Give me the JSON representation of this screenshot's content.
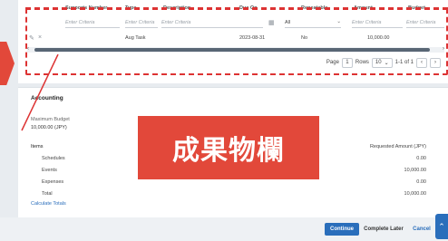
{
  "grid": {
    "columns": [
      "Supports Number",
      "Type",
      "Description",
      "Due On",
      "Repeatable",
      "Amount",
      "Budget"
    ],
    "filters": {
      "placeholder": "Enter Criteria",
      "due_select": "All"
    },
    "row": {
      "description": "Aug Task",
      "due_on": "2023-08-31",
      "repeatable": "No",
      "amount": "10,000.00"
    },
    "pager": {
      "page_label": "Page",
      "page_value": "1",
      "rows_label": "Rows",
      "rows_value": "10",
      "range": "1-1 of 1"
    }
  },
  "accounting": {
    "title": "Accounting",
    "max_budget_label": "Maximum Budget",
    "max_budget_value": "10,000.00 (JPY)",
    "items_header": "Items",
    "requested_header": "Requested Amount (JPY)",
    "rows": [
      {
        "name": "Schedules",
        "value": "0.00"
      },
      {
        "name": "Events",
        "value": "10,000.00"
      },
      {
        "name": "Expenses",
        "value": "0.00"
      },
      {
        "name": "Total",
        "value": "10,000.00"
      }
    ],
    "calculate_link": "Calculate Totals"
  },
  "overlay": {
    "text": "成果物欄",
    "color": "#e2483a"
  },
  "footer": {
    "continue": "Continue",
    "complete_later": "Complete Later",
    "cancel": "Cancel"
  },
  "colors": {
    "accent": "#2a6ebb",
    "highlight": "#dd3333"
  }
}
